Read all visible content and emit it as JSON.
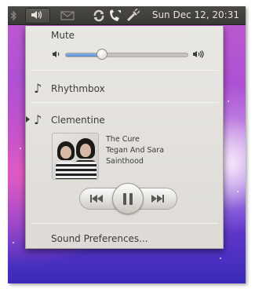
{
  "panel": {
    "clock": "Sun Dec 12, 20:31",
    "icons": [
      "bluetooth-icon",
      "sound-icon",
      "mail-icon",
      "network-icon",
      "chat-icon",
      "power-icon"
    ]
  },
  "menu": {
    "mute_label": "Mute",
    "volume_level": 0.3,
    "players": [
      {
        "label": "Rhythmbox",
        "active": false
      },
      {
        "label": "Clementine",
        "active": true
      }
    ],
    "now_playing": {
      "artist": "The Cure",
      "title": "Tegan And Sara",
      "album": "Sainthood"
    },
    "sound_prefs_label": "Sound Preferences..."
  },
  "colors": {
    "panel_bg": "#3c3b37",
    "menu_bg": "#e9e7e3",
    "slider_fill": "#6b98d8",
    "text": "#3c3b37"
  }
}
